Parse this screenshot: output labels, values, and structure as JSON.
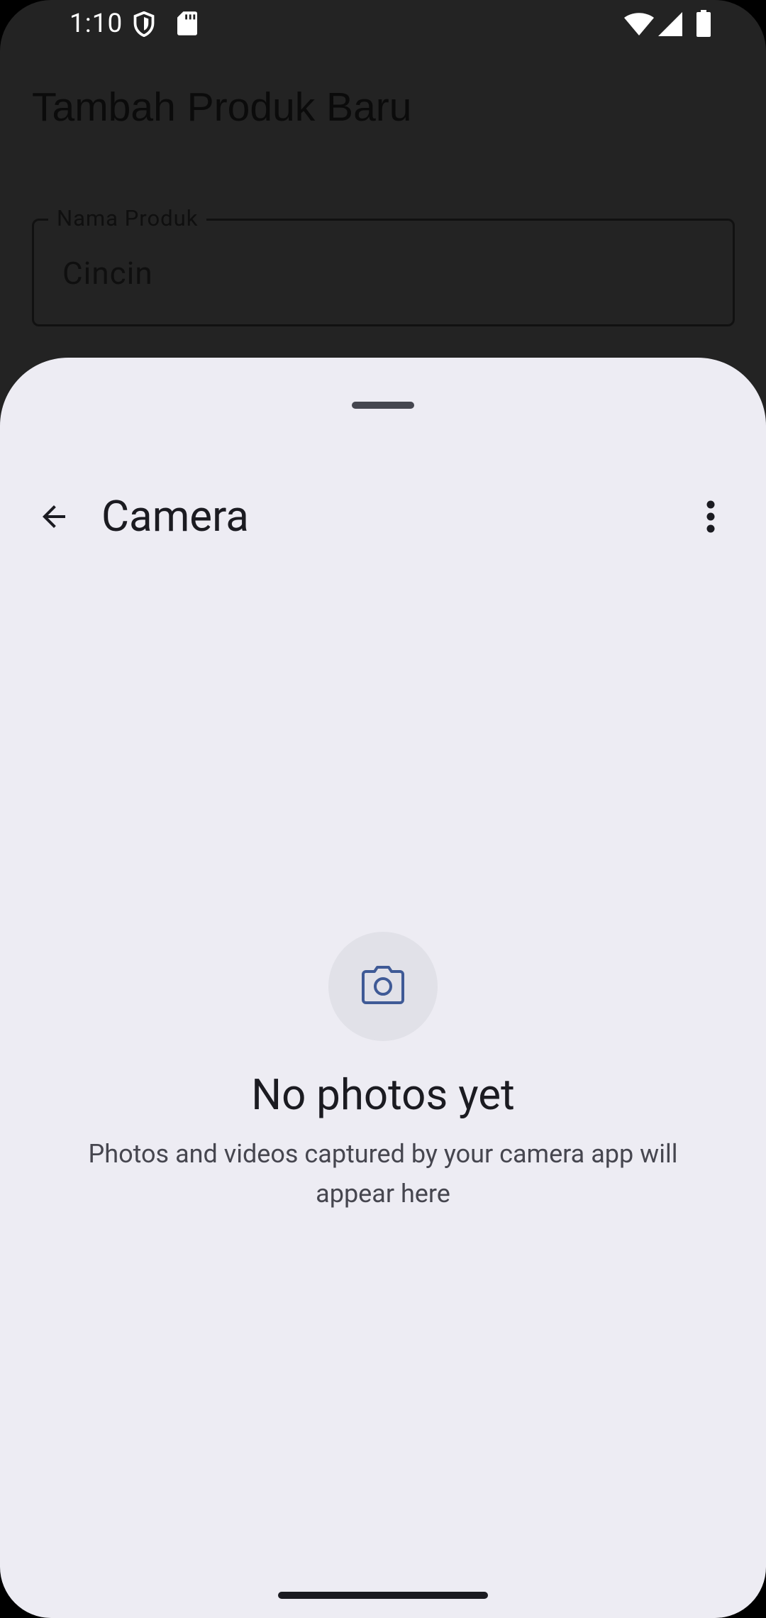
{
  "status_bar": {
    "time": "1:10",
    "icons": [
      "shield-icon",
      "sd-card-icon",
      "wifi-icon",
      "cellular-signal-icon",
      "battery-icon"
    ]
  },
  "background_app": {
    "title": "Tambah Produk Baru",
    "field_label": "Nama Produk",
    "field_value": "Cincin"
  },
  "sheet": {
    "title": "Camera",
    "back_icon": "arrow-back-icon",
    "menu_icon": "more-vert-icon",
    "empty_state": {
      "icon": "camera-icon",
      "title": "No photos yet",
      "description": "Photos and videos captured by your camera app will appear here"
    }
  },
  "colors": {
    "sheet_background": "#edecf3",
    "accent": "#3f5a96",
    "text_primary": "#1b1b21",
    "text_secondary": "#46464f"
  }
}
